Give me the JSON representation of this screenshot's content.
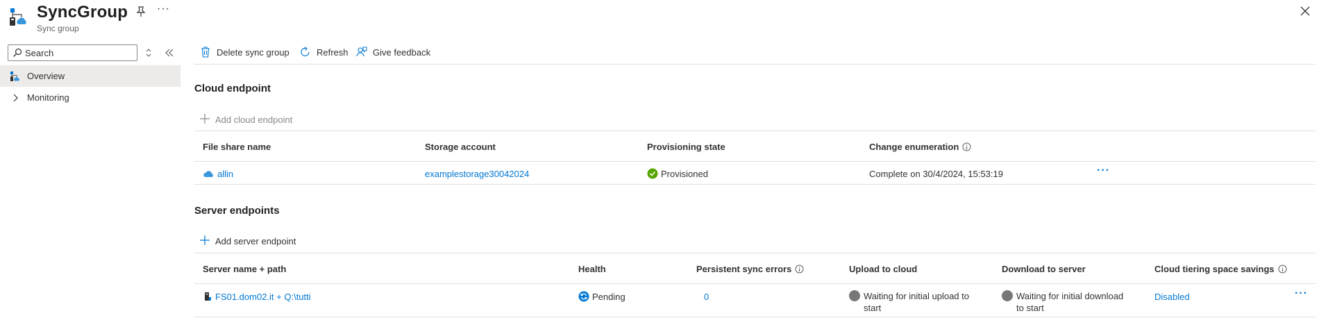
{
  "header": {
    "title": "SyncGroup",
    "subtitle": "Sync group",
    "more_glyph": "···"
  },
  "sidebar": {
    "search": {
      "placeholder": "Search",
      "value": ""
    },
    "items": [
      {
        "label": "Overview",
        "icon": "sync-group-icon",
        "selected": true
      },
      {
        "label": "Monitoring",
        "icon": "chevron-right-icon",
        "selected": false
      }
    ]
  },
  "toolbar": {
    "delete_label": "Delete sync group",
    "refresh_label": "Refresh",
    "feedback_label": "Give feedback"
  },
  "cloud_endpoint": {
    "section_title": "Cloud endpoint",
    "add_label": "Add cloud endpoint",
    "columns": [
      "File share name",
      "Storage account",
      "Provisioning state",
      "Change enumeration"
    ],
    "row": {
      "file_share": "allin",
      "storage_account": "examplestorage30042024",
      "provisioning_state": "Provisioned",
      "change_enumeration": "Complete on 30/4/2024, 15:53:19",
      "more": "···"
    }
  },
  "server_endpoints": {
    "section_title": "Server endpoints",
    "add_label": "Add server endpoint",
    "columns": [
      "Server name + path",
      "Health",
      "Persistent sync errors",
      "Upload to cloud",
      "Download to server",
      "Cloud tiering space savings"
    ],
    "row": {
      "server_path": "FS01.dom02.it + Q:\\tutti",
      "health": "Pending",
      "persistent_errors": "0",
      "upload": "Waiting for initial upload to start",
      "download": "Waiting for initial download to start",
      "cloud_tiering": "Disabled",
      "more": "···"
    }
  },
  "colors": {
    "accent": "#0078d4",
    "success": "#57a300",
    "neutral_status": "#797775",
    "selected_bg": "#edebe9"
  }
}
